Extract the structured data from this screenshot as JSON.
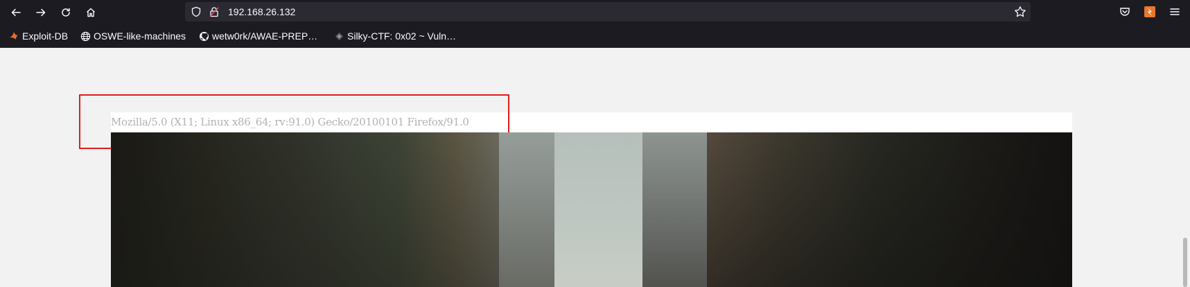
{
  "browser": {
    "url": "192.168.26.132",
    "bookmarks": [
      {
        "label": "Exploit-DB",
        "icon": "exploit-db-icon"
      },
      {
        "label": "OSWE-like-machines",
        "icon": "globe-icon"
      },
      {
        "label": "wetw0rk/AWAE-PREP…",
        "icon": "github-icon"
      },
      {
        "label": "Silky-CTF: 0x02 ~ Vuln…",
        "icon": "vulnhub-icon"
      }
    ]
  },
  "page": {
    "user_agent": "Mozilla/5.0 (X11; Linux x86_64; rv:91.0) Gecko/20100101 Firefox/91.0"
  },
  "colors": {
    "chrome": "#1c1b22",
    "urlbar": "#2b2a33",
    "highlight": "#e31b1b",
    "page_bg": "#f2f2f2"
  }
}
